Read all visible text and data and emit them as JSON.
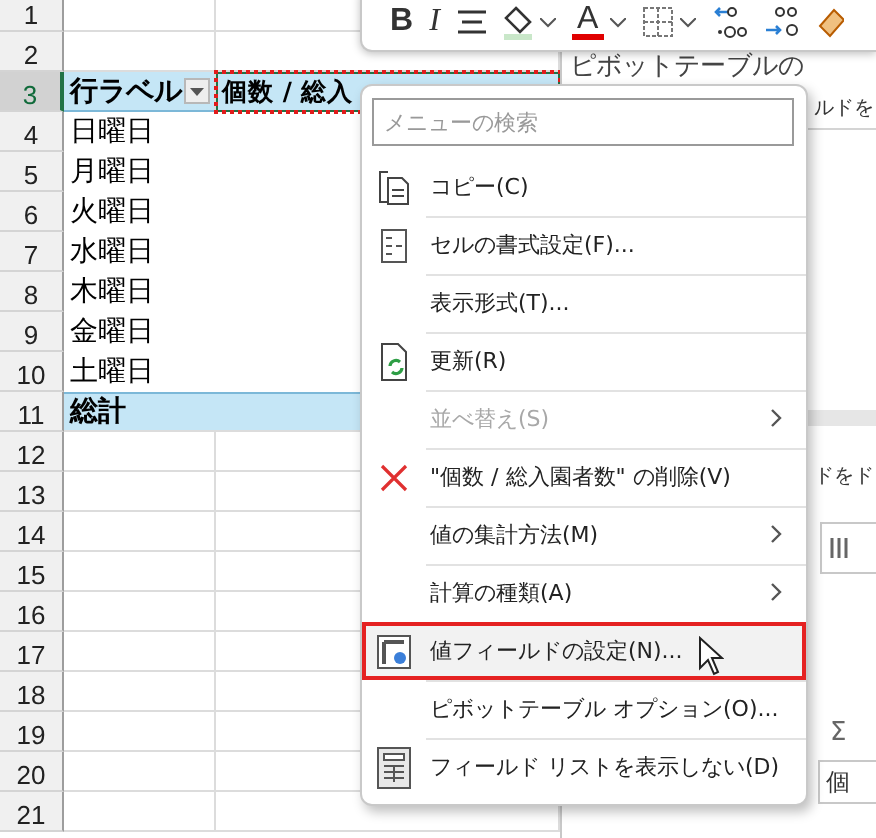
{
  "mini_toolbar": {
    "buttons": [
      {
        "kind": "bold",
        "label": "B"
      },
      {
        "kind": "italic",
        "label": "I"
      },
      {
        "kind": "align"
      },
      {
        "kind": "fill"
      },
      {
        "kind": "font_color",
        "label": "A"
      },
      {
        "kind": "borders"
      },
      {
        "kind": "decrease_decimal"
      },
      {
        "kind": "increase_decimal"
      },
      {
        "kind": "eraser"
      }
    ]
  },
  "sheet": {
    "rows": [
      {
        "number": "1",
        "kind": "blank",
        "selected": false,
        "cells": []
      },
      {
        "number": "2",
        "kind": "blank",
        "selected": false,
        "cells": []
      },
      {
        "number": "3",
        "kind": "header",
        "selected": true,
        "cells": [
          "行ラベル",
          "個数 / 総入"
        ]
      },
      {
        "number": "4",
        "kind": "item",
        "selected": false,
        "cells": [
          "日曜日"
        ]
      },
      {
        "number": "5",
        "kind": "item",
        "selected": false,
        "cells": [
          "月曜日"
        ]
      },
      {
        "number": "6",
        "kind": "item",
        "selected": false,
        "cells": [
          "火曜日"
        ]
      },
      {
        "number": "7",
        "kind": "item",
        "selected": false,
        "cells": [
          "水曜日"
        ]
      },
      {
        "number": "8",
        "kind": "item",
        "selected": false,
        "cells": [
          "木曜日"
        ]
      },
      {
        "number": "9",
        "kind": "item",
        "selected": false,
        "cells": [
          "金曜日"
        ]
      },
      {
        "number": "10",
        "kind": "item",
        "selected": false,
        "cells": [
          "土曜日"
        ]
      },
      {
        "number": "11",
        "kind": "total",
        "selected": false,
        "cells": [
          "総計"
        ]
      },
      {
        "number": "12",
        "kind": "blank",
        "selected": false,
        "cells": []
      },
      {
        "number": "13",
        "kind": "blank",
        "selected": false,
        "cells": []
      },
      {
        "number": "14",
        "kind": "blank",
        "selected": false,
        "cells": []
      },
      {
        "number": "15",
        "kind": "blank",
        "selected": false,
        "cells": []
      },
      {
        "number": "16",
        "kind": "blank",
        "selected": false,
        "cells": []
      },
      {
        "number": "17",
        "kind": "blank",
        "selected": false,
        "cells": []
      },
      {
        "number": "18",
        "kind": "blank",
        "selected": false,
        "cells": []
      },
      {
        "number": "19",
        "kind": "blank",
        "selected": false,
        "cells": []
      },
      {
        "number": "20",
        "kind": "blank",
        "selected": false,
        "cells": []
      },
      {
        "number": "21",
        "kind": "blank",
        "selected": false,
        "cells": []
      }
    ]
  },
  "pivot_pane": {
    "title": "ピボットテーブルの",
    "hint_1": "ルドを",
    "hint_2": "ドをド",
    "values_label": "Σ",
    "value_field": "個"
  },
  "context_menu": {
    "search": {
      "placeholder": "メニューの検索"
    },
    "items": [
      {
        "label": "コピー(C)",
        "kind": "copy",
        "disabled": false,
        "submenu": false,
        "highlighted": false
      },
      {
        "label": "セルの書式設定(F)...",
        "kind": "format",
        "disabled": false,
        "submenu": false,
        "highlighted": false
      },
      {
        "label": "表示形式(T)...",
        "kind": "plain",
        "disabled": false,
        "submenu": false,
        "highlighted": false
      },
      {
        "label": "更新(R)",
        "kind": "refresh",
        "disabled": false,
        "submenu": false,
        "highlighted": false
      },
      {
        "label": "並べ替え(S)",
        "kind": "plain",
        "disabled": true,
        "submenu": true,
        "highlighted": false
      },
      {
        "label": "\"個数 / 総入園者数\" の削除(V)",
        "kind": "delete",
        "disabled": false,
        "submenu": false,
        "highlighted": false
      },
      {
        "label": "値の集計方法(M)",
        "kind": "plain",
        "disabled": false,
        "submenu": true,
        "highlighted": false
      },
      {
        "label": "計算の種類(A)",
        "kind": "plain",
        "disabled": false,
        "submenu": true,
        "highlighted": false
      },
      {
        "label": "値フィールドの設定(N)...",
        "kind": "field_settings",
        "disabled": false,
        "submenu": false,
        "highlighted": true
      },
      {
        "label": "ピボットテーブル オプション(O)...",
        "kind": "plain",
        "disabled": false,
        "submenu": false,
        "highlighted": false
      },
      {
        "label": "フィールド リストを表示しない(D)",
        "kind": "field_list",
        "disabled": false,
        "submenu": false,
        "highlighted": false
      }
    ]
  }
}
